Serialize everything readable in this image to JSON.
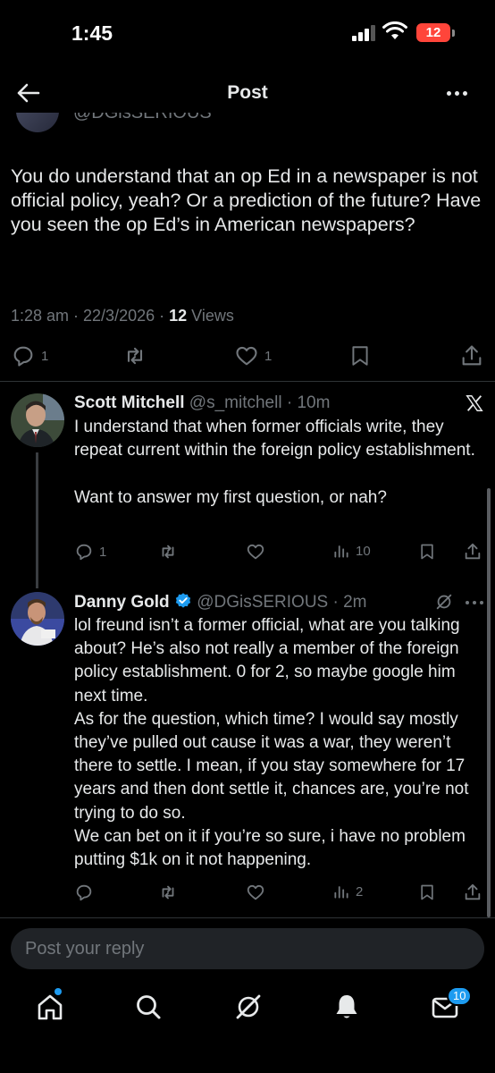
{
  "status_bar": {
    "time": "1:45",
    "battery": "12"
  },
  "nav": {
    "title": "Post"
  },
  "cut_post": {
    "handle": "@DGisSERIOUS"
  },
  "main_post": {
    "text": "You do understand that an op Ed in a newspaper is not official policy, yeah? Or a prediction of the future? Have you seen the op Ed’s in American newspapers?",
    "time": "1:28 am · 22/3/2026 · ",
    "views_count": "12",
    "views_label": " Views",
    "replies": "1",
    "likes": "1"
  },
  "replies": [
    {
      "name": "Scott Mitchell",
      "handle": "@s_mitchell",
      "time": " · 10m",
      "text": "I understand that when former officials write, they repeat current within the foreign policy establishment.\n\nWant to answer my first question, or nah?",
      "replies": "1",
      "views": "10"
    },
    {
      "name": "Danny Gold",
      "handle": "@DGisSERIOUS",
      "time": " · 2m",
      "text": "lol freund isn’t a former official, what are you talking about? He’s also not really a member of the foreign policy establishment. 0 for 2, so maybe google him next time.\nAs for the question, which time? I would say mostly they’ve pulled out cause it was a war, they weren’t there to settle. I mean, if you stay somewhere for 17 years and then dont settle it, chances are, you’re not trying to do so.\nWe can bet on it if you’re so sure, i have no problem putting $1k on it not happening.",
      "views": "2"
    }
  ],
  "reply_box": {
    "placeholder": "Post your reply"
  },
  "tab_bar": {
    "messages_badge": "10"
  },
  "colors": {
    "accent": "#1d9bf0",
    "muted": "#71767b",
    "text": "#e7e9ea",
    "background": "#000000"
  }
}
